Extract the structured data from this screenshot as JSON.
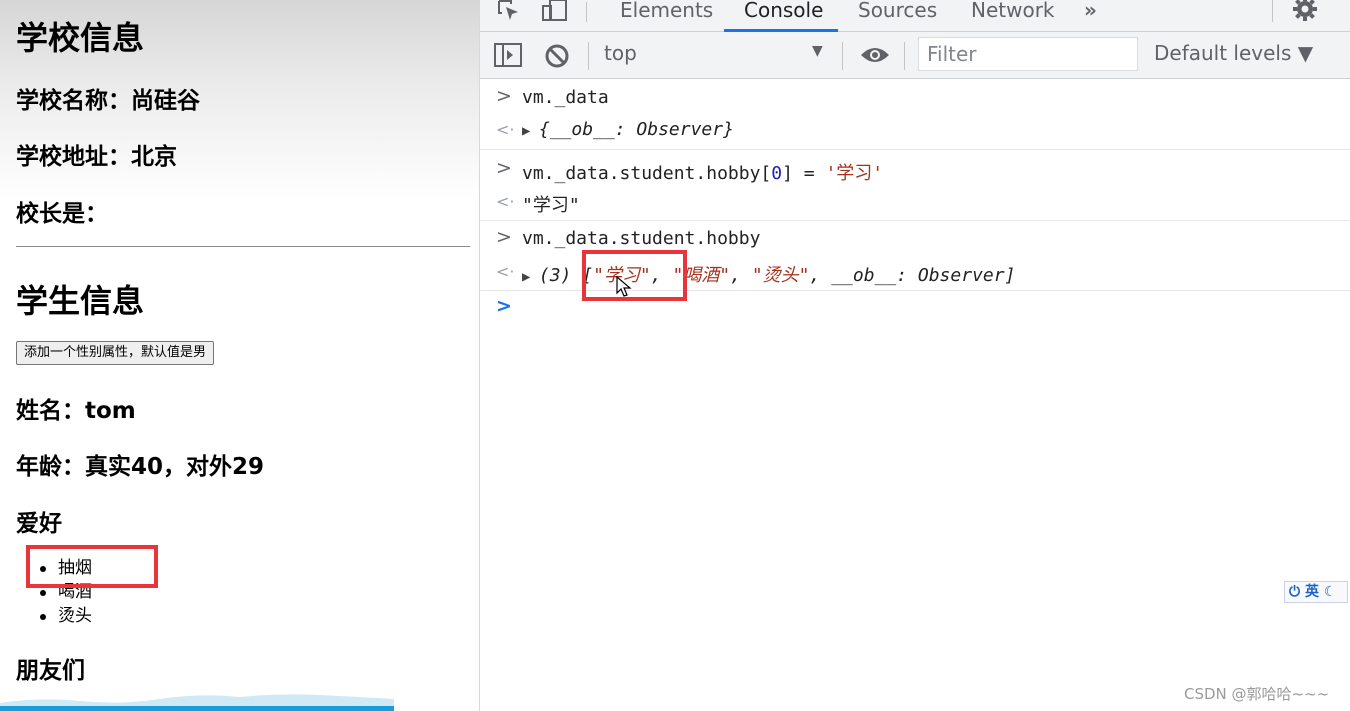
{
  "page": {
    "school_heading": "学校信息",
    "school_name": "学校名称：尚硅谷",
    "school_address": "学校地址：北京",
    "principal": "校长是：",
    "student_heading": "学生信息",
    "add_gender_button": "添加一个性别属性，默认值是男",
    "student_name": "姓名：tom",
    "student_age": "年龄：真实40，对外29",
    "hobby_heading": "爱好",
    "hobbies": [
      "抽烟",
      "喝酒",
      "烫头"
    ],
    "friends_heading": "朋友们"
  },
  "devtools": {
    "tabs": [
      "Elements",
      "Console",
      "Sources",
      "Network"
    ],
    "active_tab": "Console",
    "more_tabs_label": "»",
    "context_selector": "top",
    "filter_placeholder": "Filter",
    "levels_dropdown": "Default levels ▼",
    "console": [
      {
        "input": "vm._data",
        "output": "{__ob__: Observer}"
      },
      {
        "input_prefix": "vm._data.student.hobby[",
        "input_index": "0",
        "input_mid": "] = ",
        "input_str": "'学习'",
        "output": "\"学习\""
      },
      {
        "input": "vm._data.student.hobby",
        "output_count": "(3)",
        "output_items": [
          "\"学习\"",
          "\"喝酒\"",
          "\"烫头\""
        ],
        "output_tail": "__ob__: Observer]"
      }
    ],
    "prompt_symbol": ">"
  },
  "ime_indicator": "英",
  "watermark": "CSDN @郭哈哈~~~",
  "colors": {
    "highlight_box": "#e8353b",
    "active_tab_underline": "#1a73e8",
    "string_color": "#a3311c"
  }
}
